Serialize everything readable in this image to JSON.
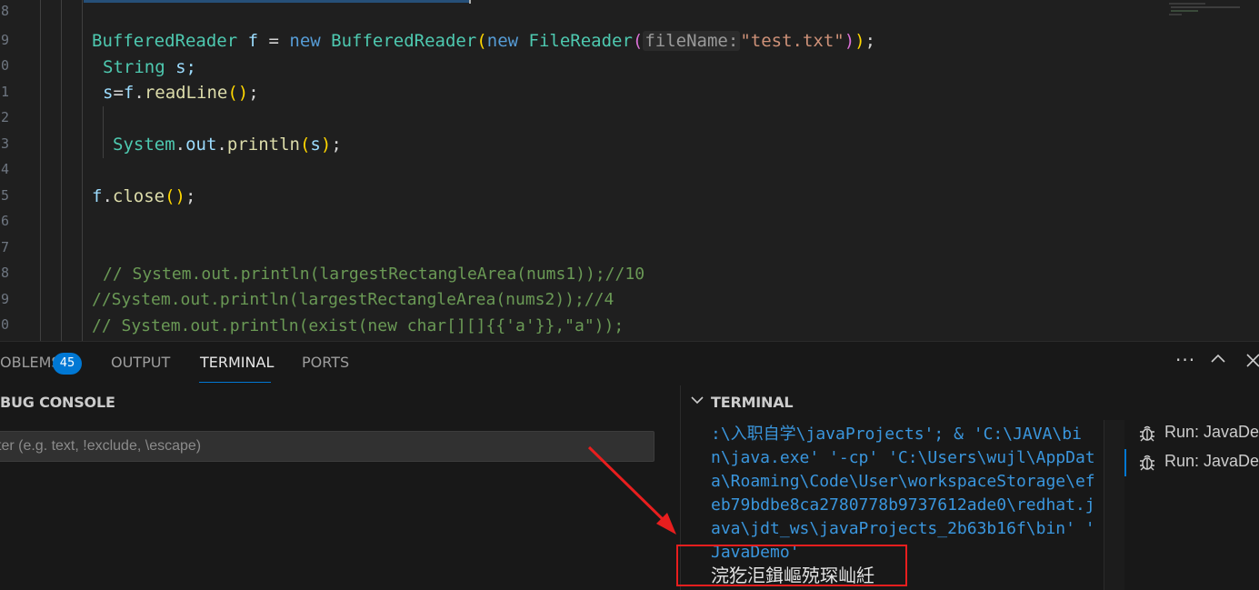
{
  "editor": {
    "line_numbers": [
      "8",
      "9",
      "0",
      "1",
      "2",
      "3",
      "4",
      "5",
      "6",
      "7",
      "8",
      "9",
      "0"
    ],
    "code": {
      "l1": {
        "t1": "BufferedReader",
        "t2": " f ",
        "t3": "= ",
        "t4": "new ",
        "t5": "BufferedReader",
        "t6": "(",
        "t7": "new ",
        "t8": "FileReader",
        "t9": "(",
        "hint": "fileName:",
        "t10": "\"test.txt\"",
        "t11": ")",
        "t12": ")",
        "t13": ";"
      },
      "l2": {
        "t1": "String",
        "t2": " s;"
      },
      "l3": {
        "t1": "s",
        "t2": "=",
        "t3": "f",
        "t4": ".",
        "t5": "readLine",
        "t6": "()",
        "t7": ";"
      },
      "l4": {
        "t1": "System",
        "t2": ".",
        "t3": "out",
        "t4": ".",
        "t5": "println",
        "t6": "(",
        "t7": "s",
        "t8": ")",
        "t9": ";"
      },
      "l5": {
        "t1": "f",
        "t2": ".",
        "t3": "close",
        "t4": "()",
        "t5": ";"
      },
      "c1": "// System.out.println(largestRectangleArea(nums1));//10",
      "c2": "//System.out.println(largestRectangleArea(nums2));//4",
      "c3": "// System.out.println(exist(new char[][]{{'a'}},\"a\"));"
    }
  },
  "panel": {
    "tabs": {
      "problems": "OBLEMS",
      "problems_count": "45",
      "output": "OUTPUT",
      "terminal": "TERMINAL",
      "ports": "PORTS"
    },
    "icons": {
      "more": "more-icon",
      "maximize": "chevron-up-icon",
      "close": "close-icon"
    },
    "debug_console": {
      "title": "BUG CONSOLE",
      "filter_placeholder": "ter (e.g. text, !exclude, \\escape)"
    },
    "terminal": {
      "title": "TERMINAL",
      "lines": [
        ":\\入职自学\\javaProjects'; & 'C:\\JAVA\\bi",
        "n\\java.exe' '-cp' 'C:\\Users\\wujl\\AppDat",
        "a\\Roaming\\Code\\User\\workspaceStorage\\ef",
        "eb79bdbe8ca2780778b9737612ade0\\redhat.j",
        "ava\\jdt_ws\\javaProjects_2b63b16f\\bin' '",
        "JavaDemo'"
      ],
      "output": "浣犵洰鍓嶇殑琛屾紝",
      "sessions": [
        {
          "label": "Run: JavaDe"
        },
        {
          "label": "Run: JavaDe"
        }
      ]
    }
  },
  "colors": {
    "accent": "#0078d4",
    "annotation": "#e81e1e",
    "terminal_text": "#3a96dd"
  }
}
